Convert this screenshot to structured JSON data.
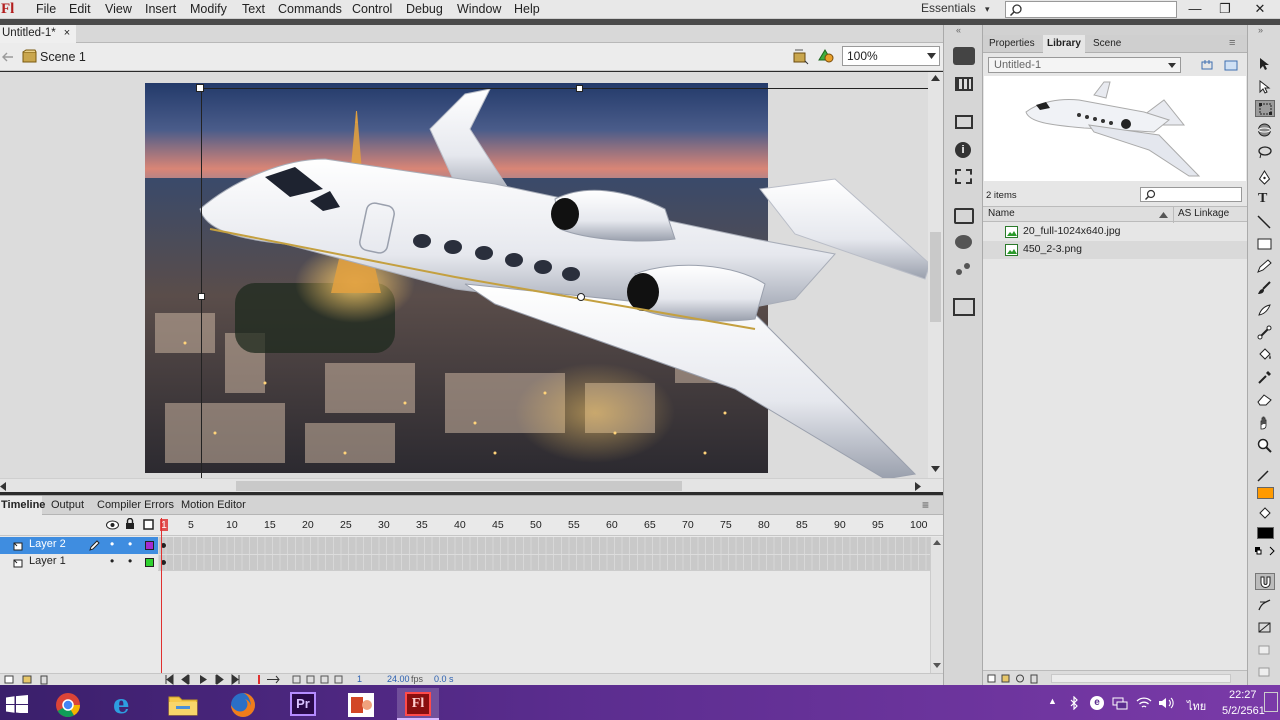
{
  "app": {
    "logo": "Fl"
  },
  "menu": [
    "File",
    "Edit",
    "View",
    "Insert",
    "Modify",
    "Text",
    "Commands",
    "Control",
    "Debug",
    "Window",
    "Help"
  ],
  "workspace": {
    "label": "Essentials",
    "caret": "▾"
  },
  "window_controls": {
    "minimize": "—",
    "restore": "❐",
    "close": "✕"
  },
  "document": {
    "tab": "Untitled-1*",
    "close": "×",
    "scene": "Scene 1",
    "zoom": "100%"
  },
  "panels": {
    "tabs": [
      "Properties",
      "Library",
      "Scene"
    ],
    "active_tab": "Library",
    "library_doc": "Untitled-1",
    "item_count": "2 items",
    "columns": {
      "name": "Name",
      "linkage": "AS Linkage"
    },
    "items": [
      {
        "name": "20_full-1024x640.jpg"
      },
      {
        "name": "450_2-3.png"
      }
    ]
  },
  "timeline": {
    "tabs": [
      "Timeline",
      "Output",
      "Compiler Errors",
      "Motion Editor"
    ],
    "active_tab": "Timeline",
    "frame_numbers": [
      "1",
      "5",
      "10",
      "15",
      "20",
      "25",
      "30",
      "35",
      "40",
      "45",
      "50",
      "55",
      "60",
      "65",
      "70",
      "75",
      "80",
      "85",
      "90",
      "95",
      "100"
    ],
    "layers": [
      {
        "name": "Layer 2",
        "color": "#a52bd1",
        "selected": true
      },
      {
        "name": "Layer 1",
        "color": "#2fd12f",
        "selected": false
      }
    ],
    "status": {
      "frame": "1",
      "fps": "24.00",
      "fps_unit": "fps",
      "time": "0.0 s"
    }
  },
  "tray": {
    "lang": "ไทย",
    "time": "22:27",
    "date": "5/2/2561"
  },
  "colors": {
    "accent_layer_select": "#3f8de0",
    "flash_red": "#b31e1e",
    "stroke_swatch": "#ff9a00",
    "fill_swatch": "#000000",
    "taskbar": "#5b2d8f"
  },
  "taskbar_apps": [
    "windows-start",
    "chrome",
    "internet-explorer",
    "file-explorer",
    "firefox",
    "premiere-pro",
    "powerpoint",
    "flash"
  ]
}
